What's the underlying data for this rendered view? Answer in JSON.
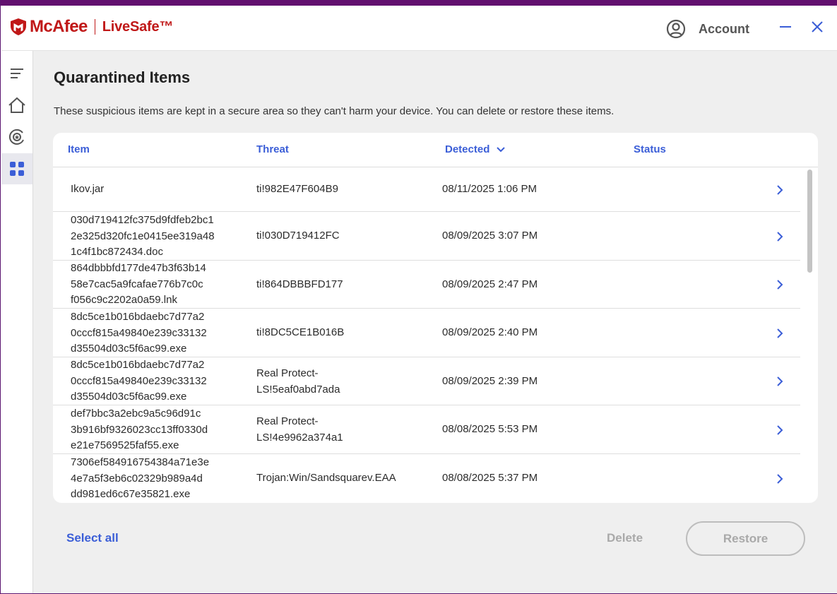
{
  "brand": {
    "name": "McAfee",
    "product": "LiveSafe™"
  },
  "header": {
    "account_label": "Account"
  },
  "page": {
    "title": "Quarantined Items",
    "description": "These suspicious items are kept in a secure area so they can't harm your device. You can delete or restore these items."
  },
  "table": {
    "columns": {
      "item": "Item",
      "threat": "Threat",
      "detected": "Detected",
      "status": "Status"
    },
    "rows": [
      {
        "item": [
          "Ikov.jar"
        ],
        "threat": [
          "ti!982E47F604B9"
        ],
        "detected": "08/11/2025 1:06 PM",
        "status": ""
      },
      {
        "item": [
          "030d719412fc375d9fdfeb2bc1",
          "2e325d320fc1e0415ee319a48",
          "1c4f1bc872434.doc"
        ],
        "threat": [
          "ti!030D719412FC"
        ],
        "detected": "08/09/2025 3:07 PM",
        "status": ""
      },
      {
        "item": [
          "864dbbbfd177de47b3f63b14",
          "58e7cac5a9fcafae776b7c0c",
          "f056c9c2202a0a59.lnk"
        ],
        "threat": [
          "ti!864DBBBFD177"
        ],
        "detected": "08/09/2025 2:47 PM",
        "status": ""
      },
      {
        "item": [
          "8dc5ce1b016bdaebc7d77a2",
          "0cccf815a49840e239c33132",
          "d35504d03c5f6ac99.exe"
        ],
        "threat": [
          "ti!8DC5CE1B016B"
        ],
        "detected": "08/09/2025 2:40 PM",
        "status": ""
      },
      {
        "item": [
          "8dc5ce1b016bdaebc7d77a2",
          "0cccf815a49840e239c33132",
          "d35504d03c5f6ac99.exe"
        ],
        "threat": [
          "Real Protect-",
          "LS!5eaf0abd7ada"
        ],
        "detected": "08/09/2025 2:39 PM",
        "status": ""
      },
      {
        "item": [
          "def7bbc3a2ebc9a5c96d91c",
          "3b916bf9326023cc13ff0330d",
          "e21e7569525faf55.exe"
        ],
        "threat": [
          "Real Protect-",
          "LS!4e9962a374a1"
        ],
        "detected": "08/08/2025 5:53 PM",
        "status": ""
      },
      {
        "item": [
          "7306ef584916754384a71e3e",
          "4e7a5f3eb6c02329b989a4d",
          "dd981ed6c67e35821.exe"
        ],
        "threat": [
          "Trojan:Win/Sandsquarev.EAA"
        ],
        "detected": "08/08/2025 5:37 PM",
        "status": ""
      }
    ]
  },
  "actions": {
    "select_all": "Select all",
    "delete": "Delete",
    "restore": "Restore"
  },
  "colors": {
    "brand_red": "#c01818",
    "accent_blue": "#3b5ed7",
    "title_bar": "#62106f"
  },
  "icons": {
    "sidebar": [
      "menu-icon",
      "home-icon",
      "protection-icon",
      "apps-grid-icon"
    ],
    "header": [
      "account-icon",
      "minimize-icon",
      "close-icon"
    ],
    "row": "chevron-right-icon",
    "sort": "chevron-down-icon"
  }
}
